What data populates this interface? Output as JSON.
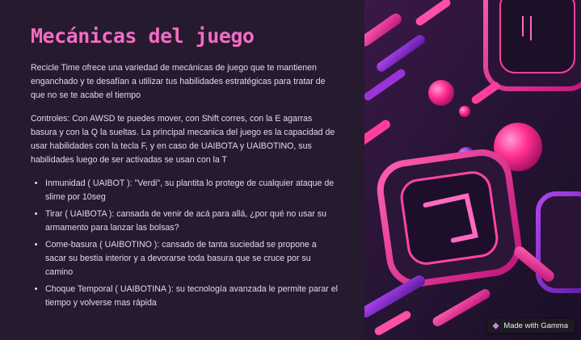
{
  "slide": {
    "title": "Mecánicas del juego",
    "intro": "Recicle Time ofrece una variedad de mecánicas de juego que te mantienen enganchado y te desafían a utilizar tus habilidades estratégicas para tratar de que no se te acabe el tiempo",
    "controls": "Controles: Con AWSD te puedes mover, con Shift corres, con la E agarras basura y con la Q la sueltas. La principal mecanica del juego es la capacidad de usar habilidades con la tecla F, y en caso de UAIBOTA y UAIBOTINO, sus habilidades luego de ser activadas se usan con la T",
    "bullets": [
      "Inmunidad ( UAIBOT ): \"Verdi\", su plantita lo protege de cualquier ataque de slime por 10seg",
      "Tirar ( UAIBOTA ): cansada de venir de acá para allá, ¿por qué no usar su armamento para lanzar las bolsas?",
      "Come-basura ( UAIBOTINO ): cansado de tanta suciedad se propone a sacar su bestia interior y a devorarse toda basura que se cruce por su camino",
      "Choque Temporal ( UAIBOTINA ): su tecnología avanzada le permite parar el tiempo y volverse mas rápida"
    ]
  },
  "badge": {
    "label": "Made with Gamma",
    "icon": "gamma-logo-icon"
  },
  "colors": {
    "background": "#251a2e",
    "title": "#f36bc4",
    "body_text": "#e3d8ea",
    "accent_pink": "#ff2f8f",
    "accent_purple": "#8a2be2"
  }
}
